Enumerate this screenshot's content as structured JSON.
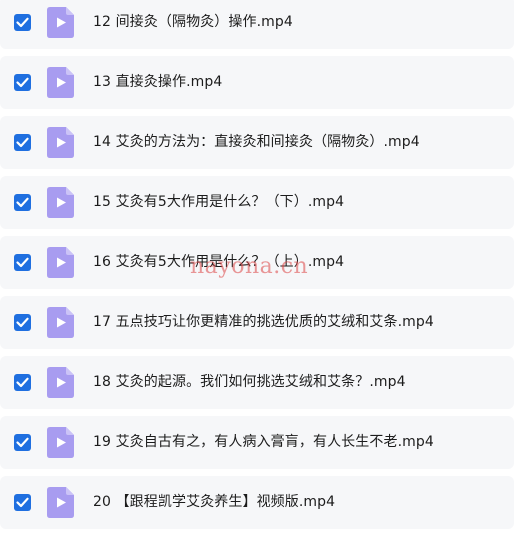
{
  "colors": {
    "checkbox": "#1f6fe0",
    "icon": "#a89cf0",
    "icon_fold": "#cbc3f7",
    "row_bg": "#f6f7f9",
    "text": "#1c1c1c",
    "watermark": "#dc4646"
  },
  "icons": {
    "checkbox": "checkmark-icon",
    "file": "video-file-icon"
  },
  "files": [
    {
      "name": "12 间接灸（隔物灸）操作.mp4",
      "checked": true
    },
    {
      "name": "13 直接灸操作.mp4",
      "checked": true
    },
    {
      "name": "14 艾灸的方法为：直接灸和间接灸（隔物灸）.mp4",
      "checked": true
    },
    {
      "name": "15 艾灸有5大作用是什么？（下）.mp4",
      "checked": true
    },
    {
      "name": "16 艾灸有5大作用是什么？（上）.mp4",
      "checked": true
    },
    {
      "name": "17 五点技巧让你更精准的挑选优质的艾绒和艾条.mp4",
      "checked": true
    },
    {
      "name": "18 艾灸的起源。我们如何挑选艾绒和艾条？.mp4",
      "checked": true
    },
    {
      "name": "19 艾灸自古有之，有人病入膏肓，有人长生不老.mp4",
      "checked": true
    },
    {
      "name": "20 【跟程凯学艾灸养生】视频版.mp4",
      "checked": true
    }
  ],
  "watermark": "nayona.cn"
}
